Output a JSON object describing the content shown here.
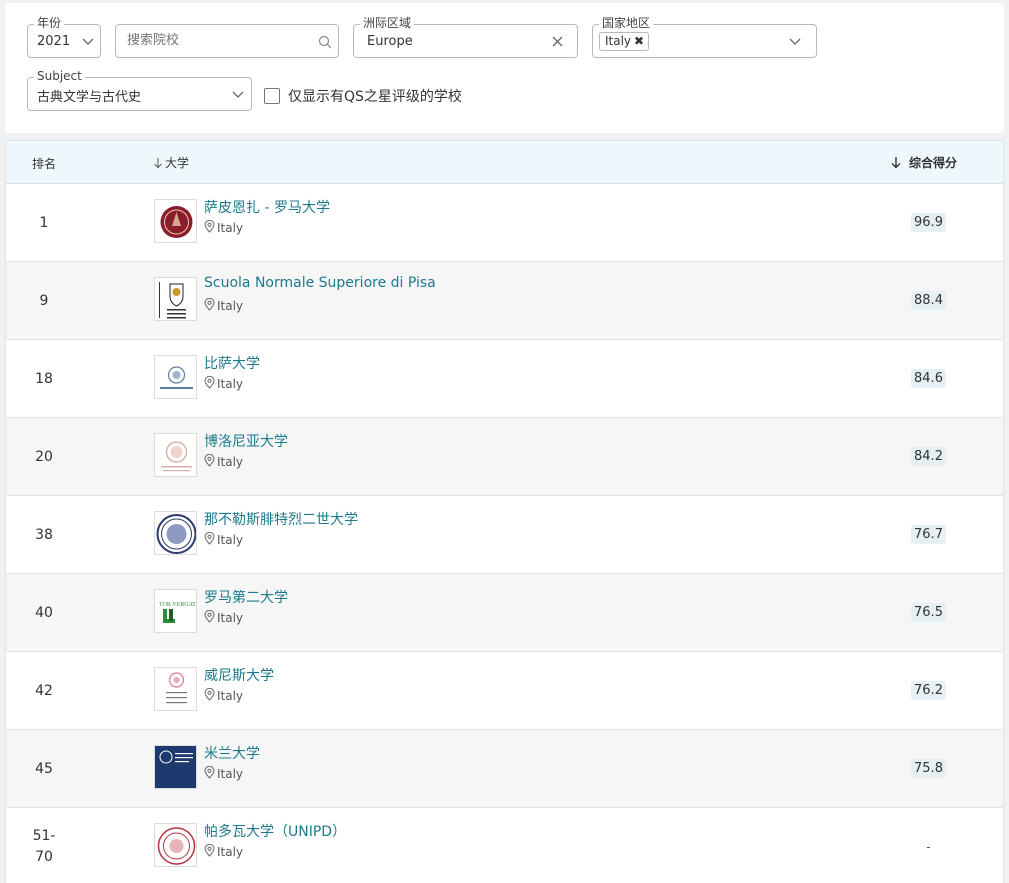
{
  "filters": {
    "year": {
      "label": "年份",
      "value": "2021"
    },
    "search": {
      "placeholder": "搜索院校"
    },
    "region": {
      "label": "洲际区域",
      "value": "Europe"
    },
    "country": {
      "label": "国家地区",
      "tag": "Italy"
    },
    "subject": {
      "label": "Subject",
      "value": "古典文学与古代史"
    },
    "qs_stars": {
      "label": "仅显示有QS之星评级的学校"
    }
  },
  "table": {
    "headers": {
      "rank": "排名",
      "university": "大学",
      "score": "综合得分"
    },
    "rows": [
      {
        "rank": "1",
        "name": "萨皮恩扎 - 罗马大学",
        "country": "Italy",
        "score": "96.9",
        "logo": "sapienza-seal"
      },
      {
        "rank": "9",
        "name": "Scuola Normale Superiore di Pisa",
        "country": "Italy",
        "score": "88.4",
        "logo": "sns-crest"
      },
      {
        "rank": "18",
        "name": "比萨大学",
        "country": "Italy",
        "score": "84.6",
        "logo": "pisa-seal"
      },
      {
        "rank": "20",
        "name": "博洛尼亚大学",
        "country": "Italy",
        "score": "84.2",
        "logo": "bologna-seal"
      },
      {
        "rank": "38",
        "name": "那不勒斯腓特烈二世大学",
        "country": "Italy",
        "score": "76.7",
        "logo": "naples-seal"
      },
      {
        "rank": "40",
        "name": "罗马第二大学",
        "country": "Italy",
        "score": "76.5",
        "logo": "tor-vergata-logo"
      },
      {
        "rank": "42",
        "name": "威尼斯大学",
        "country": "Italy",
        "score": "76.2",
        "logo": "ca-foscari-logo"
      },
      {
        "rank": "45",
        "name": "米兰大学",
        "country": "Italy",
        "score": "75.8",
        "logo": "milan-logo"
      },
      {
        "rank": "51-\n70",
        "name": "帕多瓦大学（UNIPD）",
        "country": "Italy",
        "score": "-",
        "logo": "padua-seal"
      }
    ]
  },
  "colors": {
    "accent_link": "#1b7a8c",
    "header_bg": "#eef8fc",
    "score_bg": "#e6eff4"
  }
}
